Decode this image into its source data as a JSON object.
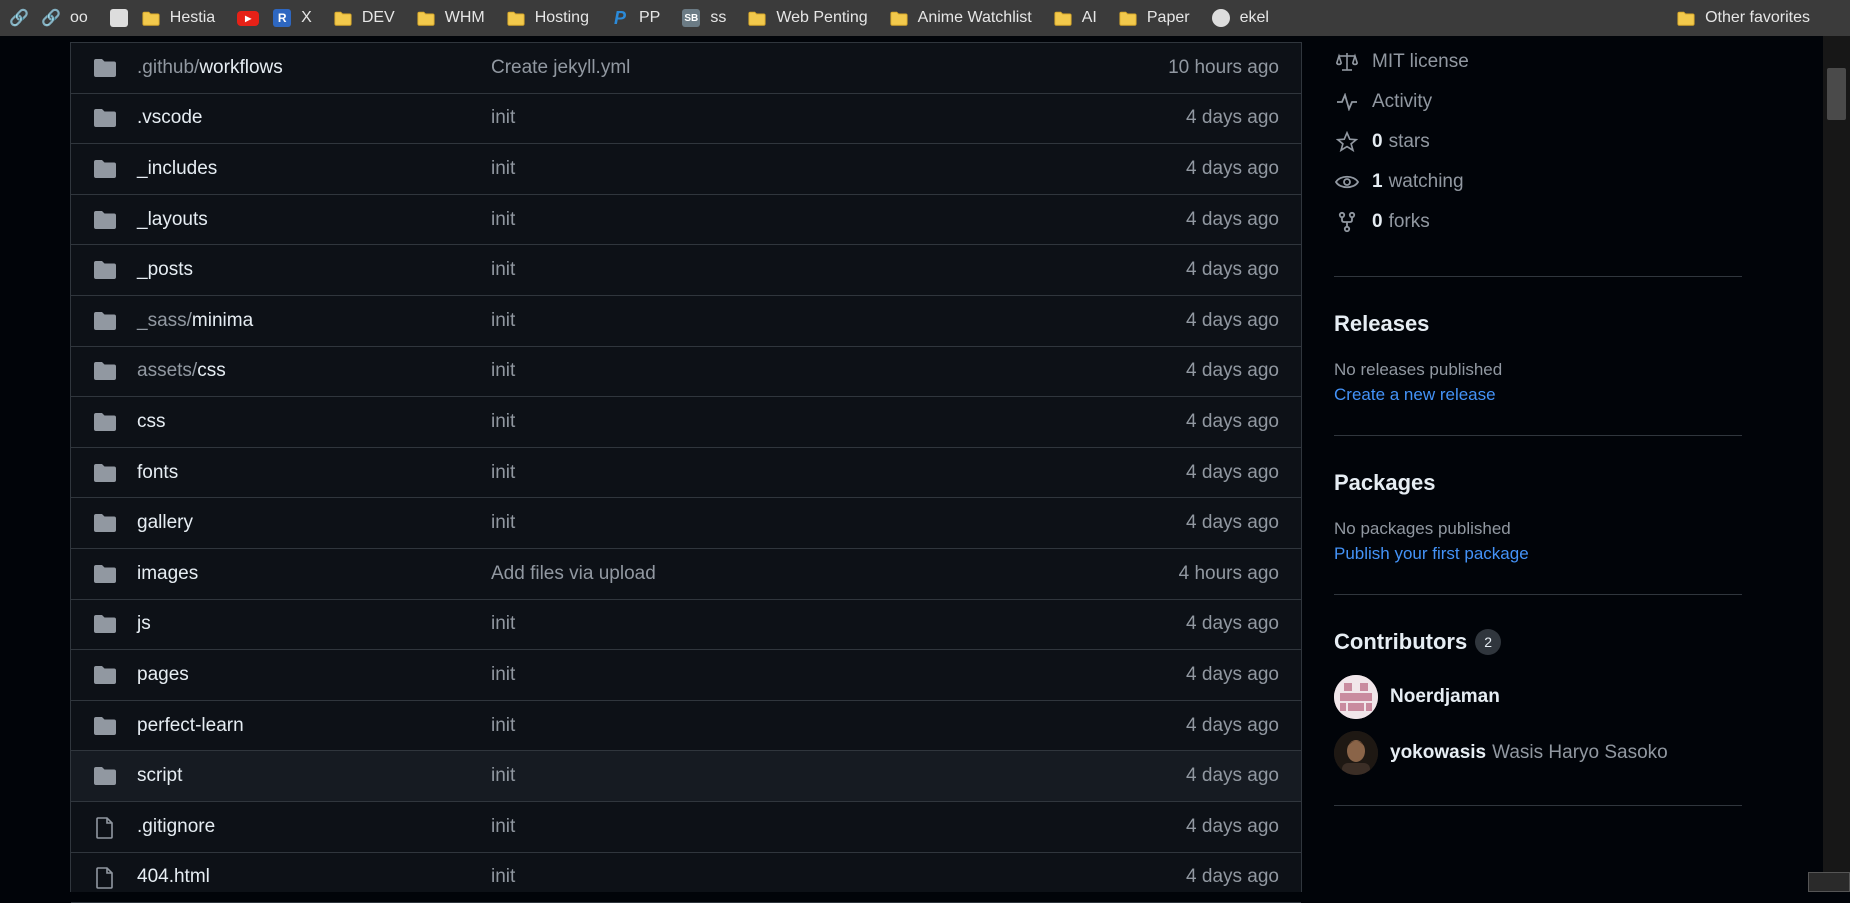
{
  "bookmarks": {
    "items": [
      {
        "label": "",
        "icon": "link-icon"
      },
      {
        "label": "oo",
        "icon": "link-icon"
      },
      {
        "label": "",
        "icon": "image-icon"
      },
      {
        "label": "Hestia",
        "icon": "folder-icon"
      },
      {
        "label": "",
        "icon": "youtube-icon"
      },
      {
        "label": "X",
        "icon": "r-icon"
      },
      {
        "label": "DEV",
        "icon": "folder-icon"
      },
      {
        "label": "WHM",
        "icon": "folder-icon"
      },
      {
        "label": "Hosting",
        "icon": "folder-icon"
      },
      {
        "label": "PP",
        "icon": "paypal-icon"
      },
      {
        "label": "ss",
        "icon": "sb-icon"
      },
      {
        "label": "Web Penting",
        "icon": "folder-icon"
      },
      {
        "label": "Anime Watchlist",
        "icon": "folder-icon"
      },
      {
        "label": "AI",
        "icon": "folder-icon"
      },
      {
        "label": "Paper",
        "icon": "folder-icon"
      },
      {
        "label": "ekel",
        "icon": "globe-icon"
      }
    ],
    "other_favorites": "Other favorites"
  },
  "files": [
    {
      "type": "dir",
      "prefix": ".github/",
      "name": "workflows",
      "message": "Create jekyll.yml",
      "date": "10 hours ago"
    },
    {
      "type": "dir",
      "prefix": "",
      "name": ".vscode",
      "message": "init",
      "date": "4 days ago"
    },
    {
      "type": "dir",
      "prefix": "",
      "name": "_includes",
      "message": "init",
      "date": "4 days ago"
    },
    {
      "type": "dir",
      "prefix": "",
      "name": "_layouts",
      "message": "init",
      "date": "4 days ago"
    },
    {
      "type": "dir",
      "prefix": "",
      "name": "_posts",
      "message": "init",
      "date": "4 days ago"
    },
    {
      "type": "dir",
      "prefix": "_sass/",
      "name": "minima",
      "message": "init",
      "date": "4 days ago"
    },
    {
      "type": "dir",
      "prefix": "assets/",
      "name": "css",
      "message": "init",
      "date": "4 days ago"
    },
    {
      "type": "dir",
      "prefix": "",
      "name": "css",
      "message": "init",
      "date": "4 days ago"
    },
    {
      "type": "dir",
      "prefix": "",
      "name": "fonts",
      "message": "init",
      "date": "4 days ago"
    },
    {
      "type": "dir",
      "prefix": "",
      "name": "gallery",
      "message": "init",
      "date": "4 days ago"
    },
    {
      "type": "dir",
      "prefix": "",
      "name": "images",
      "message": "Add files via upload",
      "date": "4 hours ago"
    },
    {
      "type": "dir",
      "prefix": "",
      "name": "js",
      "message": "init",
      "date": "4 days ago"
    },
    {
      "type": "dir",
      "prefix": "",
      "name": "pages",
      "message": "init",
      "date": "4 days ago"
    },
    {
      "type": "dir",
      "prefix": "",
      "name": "perfect-learn",
      "message": "init",
      "date": "4 days ago"
    },
    {
      "type": "dir",
      "prefix": "",
      "name": "script",
      "message": "init",
      "date": "4 days ago"
    },
    {
      "type": "file",
      "prefix": "",
      "name": ".gitignore",
      "message": "init",
      "date": "4 days ago"
    },
    {
      "type": "file",
      "prefix": "",
      "name": "404.html",
      "message": "init",
      "date": "4 days ago"
    }
  ],
  "about": {
    "license": "MIT license",
    "activity": "Activity",
    "stars_count": "0",
    "stars_label": "stars",
    "watching_count": "1",
    "watching_label": "watching",
    "forks_count": "0",
    "forks_label": "forks"
  },
  "releases": {
    "title": "Releases",
    "text": "No releases published",
    "link": "Create a new release"
  },
  "packages": {
    "title": "Packages",
    "text": "No packages published",
    "link": "Publish your first package"
  },
  "contributors": {
    "title": "Contributors",
    "count": "2",
    "people": [
      {
        "login": "Noerdjaman",
        "name": ""
      },
      {
        "login": "yokowasis",
        "name": "Wasis Haryo Sasoko"
      }
    ]
  },
  "colors": {
    "background": "#010409",
    "panel": "#0d1117",
    "border": "#30363d",
    "text": "#e6edf3",
    "muted": "#9198a1",
    "link": "#4493f8",
    "folder": "#9198a1"
  }
}
